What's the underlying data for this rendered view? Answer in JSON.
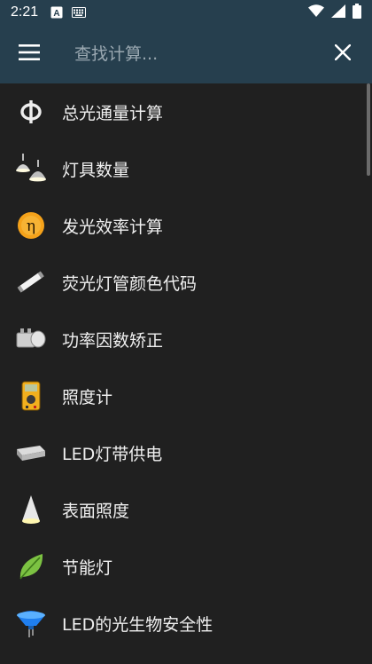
{
  "status_bar": {
    "time": "2:21",
    "icons": [
      "a-box-icon",
      "keyboard-icon",
      "wifi-icon",
      "signal-icon",
      "battery-icon"
    ]
  },
  "toolbar": {
    "menu_icon": "hamburger-icon",
    "search_placeholder": "查找计算...",
    "search_value": "",
    "close_icon": "close-icon"
  },
  "list": {
    "items": [
      {
        "label": "总光通量计算",
        "icon": "phi-icon"
      },
      {
        "label": "灯具数量",
        "icon": "lamp-icon"
      },
      {
        "label": "发光效率计算",
        "icon": "efficiency-icon"
      },
      {
        "label": "荧光灯管颜色代码",
        "icon": "fluorescent-tube-icon"
      },
      {
        "label": "功率因数矫正",
        "icon": "capacitor-icon"
      },
      {
        "label": "照度计",
        "icon": "lux-meter-icon"
      },
      {
        "label": "LED灯带供电",
        "icon": "power-supply-icon"
      },
      {
        "label": "表面照度",
        "icon": "light-cone-icon"
      },
      {
        "label": "节能灯",
        "icon": "leaf-icon"
      },
      {
        "label": "LED的光生物安全性",
        "icon": "led-icon"
      }
    ]
  },
  "colors": {
    "toolbar_bg": "#263f4e",
    "list_bg": "#202020",
    "text": "#f0f0f0"
  }
}
